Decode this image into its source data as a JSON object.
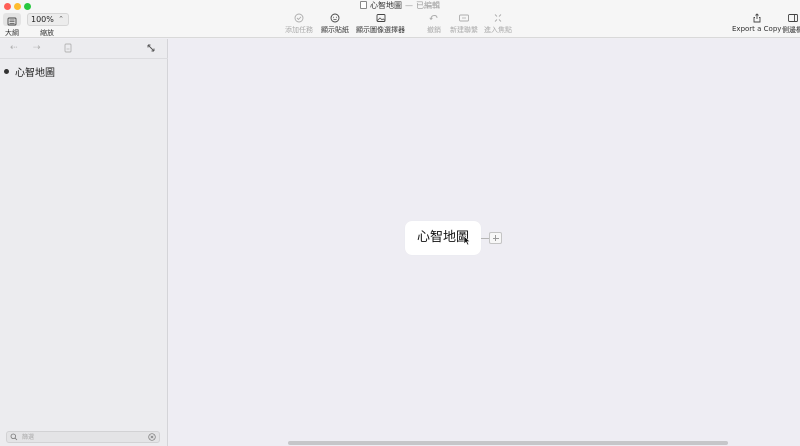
{
  "window": {
    "title": "心智地圖",
    "separator": "—",
    "status": "已編輯"
  },
  "toolbar": {
    "sidebar_label": "大綱",
    "zoom_value": "100%",
    "zoom_label": "縮放",
    "add_task": "添加任務",
    "show_sticker": "顯示貼紙",
    "show_image_picker": "顯示圖像選擇器",
    "undo": "撤銷",
    "new_relation": "新建聯繫",
    "insert_focus": "進入焦點",
    "export": "Export a Copy",
    "share": "側邊欄"
  },
  "sidebar": {
    "outline": [
      {
        "label": "心智地圖"
      }
    ],
    "search_placeholder": "篩選"
  },
  "canvas": {
    "central_node": "心智地圖"
  },
  "colors": {
    "traffic_red": "#ff5f57",
    "traffic_yellow": "#febc2e",
    "traffic_green": "#28c840",
    "canvas_bg": "#eeedf3",
    "node_bg": "#ffffff"
  }
}
